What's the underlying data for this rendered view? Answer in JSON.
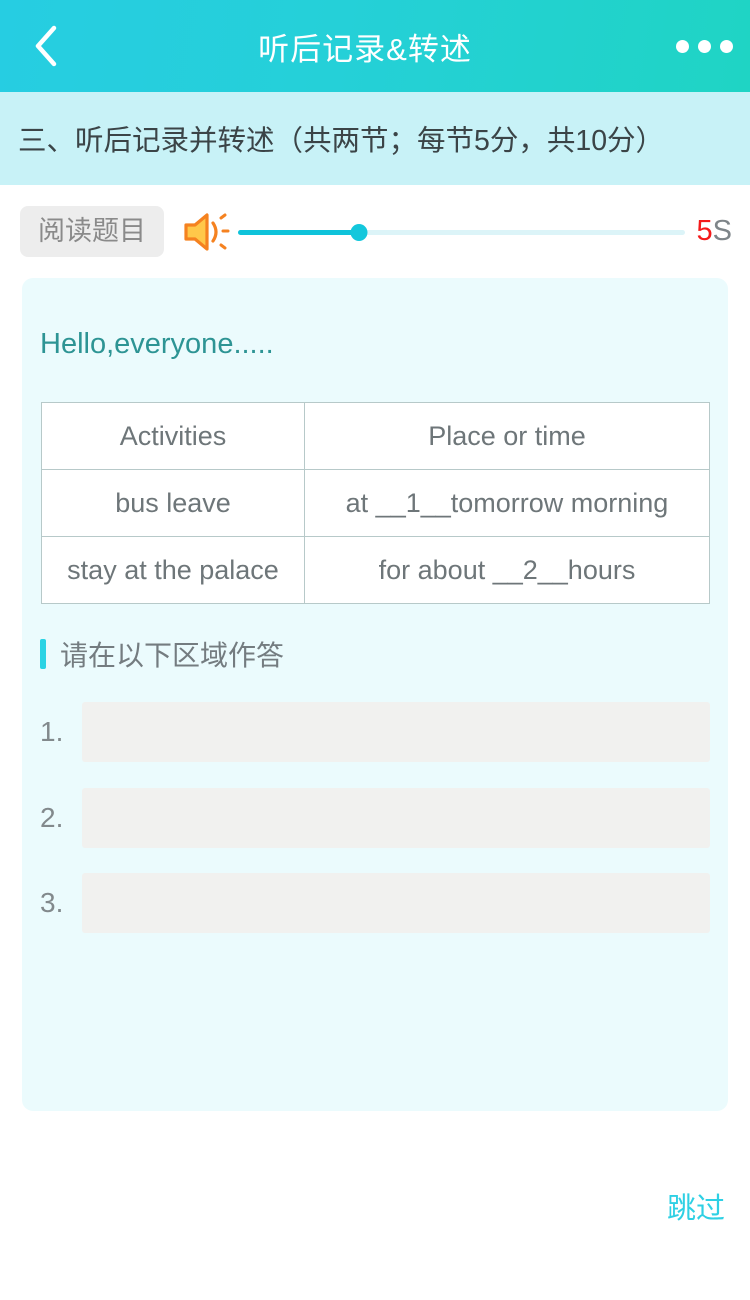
{
  "navbar": {
    "back_icon": "chevron-left-icon",
    "title": "听后记录&转述",
    "more_icon": "more-horizontal-icon"
  },
  "section": {
    "heading": "三、听后记录并转述（共两节；每节5分，共10分）"
  },
  "player": {
    "read_button_label": "阅读题目",
    "speaker_icon": "speaker-volume-icon",
    "progress_percent": 27,
    "time_remaining_value": "5",
    "time_remaining_unit": "S"
  },
  "content": {
    "greeting": "Hello,everyone.....",
    "table": {
      "headers": [
        "Activities",
        "Place or time"
      ],
      "rows": [
        [
          "bus leave",
          "at __1__tomorrow morning"
        ],
        [
          "stay at the palace",
          "for about __2__hours"
        ]
      ]
    },
    "answer_section": {
      "heading": "请在以下区域作答",
      "rows": [
        {
          "index": "1.",
          "value": "",
          "placeholder": ""
        },
        {
          "index": "2.",
          "value": "",
          "placeholder": ""
        },
        {
          "index": "3.",
          "value": "",
          "placeholder": ""
        }
      ]
    }
  },
  "footer": {
    "skip_label": "跳过"
  },
  "colors": {
    "nav_gradient_start": "#26CDE2",
    "nav_gradient_end": "#1FD4C4",
    "banner_bg": "#C8F2F7",
    "card_bg": "#EBFBFD",
    "accent_cyan": "#2BD3E4",
    "progress_fill": "#0FC3DA",
    "progress_track": "#DCF4F8",
    "speaker_body": "#FFC84A",
    "speaker_outline": "#F58220",
    "time_value_red": "#F41A1A",
    "greeting_teal": "#2D9494",
    "table_border": "#B7C9C9",
    "input_bg": "#F1F1EF",
    "badge_bg": "#EDEDED"
  }
}
